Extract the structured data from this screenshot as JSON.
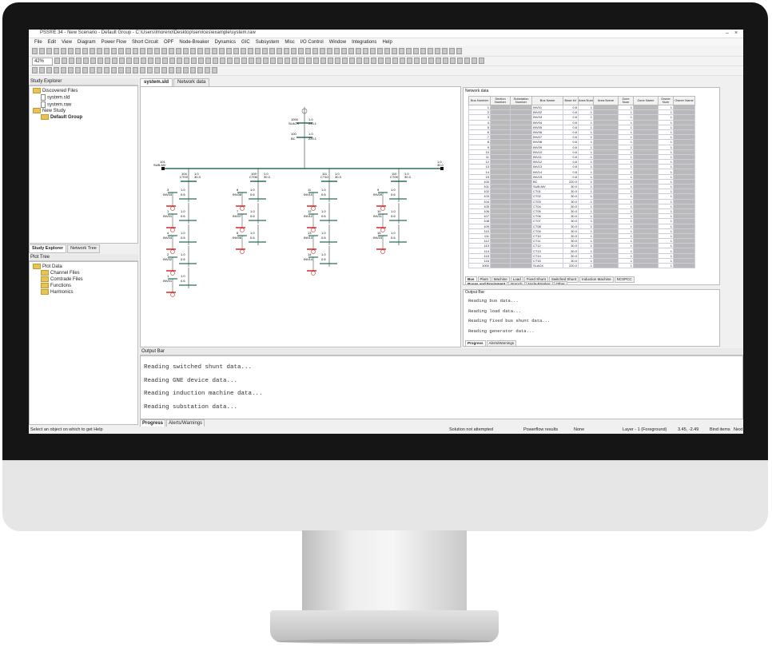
{
  "window": {
    "title": "PSS®E 34 - New Scenario - Default Group - C:\\Users\\lmoreno\\Desktop\\services\\example\\system.raw"
  },
  "menu": [
    "File",
    "Edit",
    "View",
    "Diagram",
    "Power Flow",
    "Short Circuit",
    "OPF",
    "Node-Breaker",
    "Dynamics",
    "GIC",
    "Subsystem",
    "Misc",
    "I/O Control",
    "Window",
    "Integrations",
    "Help"
  ],
  "toolbar": {
    "zoom": "42%"
  },
  "study_explorer": {
    "title": "Study Explorer",
    "items": [
      {
        "label": "Discovered Files",
        "type": "folder",
        "level": 0
      },
      {
        "label": "system.sld",
        "type": "file",
        "level": 1
      },
      {
        "label": "system.raw",
        "type": "file",
        "level": 1
      },
      {
        "label": "New Study",
        "type": "folder",
        "level": 0
      },
      {
        "label": "Default Group",
        "type": "folder-bold",
        "level": 1
      }
    ],
    "tabs": [
      "Study Explorer",
      "Network Tree"
    ]
  },
  "plot_tree": {
    "title": "Plot Tree",
    "items": [
      {
        "label": "Plot Data",
        "level": 0
      },
      {
        "label": "Channel Files",
        "level": 1
      },
      {
        "label": "Comtrade Files",
        "level": 1
      },
      {
        "label": "Functions",
        "level": 1
      },
      {
        "label": "Harmonics",
        "level": 1
      }
    ]
  },
  "doc_tabs": [
    "system.sld",
    "Network data"
  ],
  "network_data": {
    "title": "Network data",
    "columns": [
      "Bus Number",
      "Section Number",
      "Substation Number",
      "Bus Name",
      "Base kV",
      "Area Num",
      "Area Name",
      "Zone Num",
      "Zone Name",
      "Owner Num",
      "Owner Name"
    ],
    "rows": [
      [
        "1",
        "INV01",
        "0.6"
      ],
      [
        "2",
        "INV02",
        "0.6"
      ],
      [
        "3",
        "INV03",
        "0.6"
      ],
      [
        "4",
        "INV04",
        "0.6"
      ],
      [
        "5",
        "INV05",
        "0.6"
      ],
      [
        "6",
        "INV06",
        "0.6"
      ],
      [
        "7",
        "INV07",
        "0.6"
      ],
      [
        "8",
        "INV08",
        "0.6"
      ],
      [
        "9",
        "INV09",
        "0.6"
      ],
      [
        "10",
        "INV10",
        "0.6"
      ],
      [
        "11",
        "INV11",
        "0.6"
      ],
      [
        "12",
        "INV12",
        "0.6"
      ],
      [
        "13",
        "INV13",
        "0.6"
      ],
      [
        "14",
        "INV14",
        "0.6"
      ],
      [
        "15",
        "INV15",
        "0.6"
      ],
      [
        "100",
        "BC",
        "220.0"
      ],
      [
        "101",
        "SUB-MV",
        "30.0"
      ],
      [
        "102",
        "CT01",
        "30.0"
      ],
      [
        "103",
        "CT02",
        "30.0"
      ],
      [
        "104",
        "CT03",
        "30.0"
      ],
      [
        "105",
        "CT04",
        "30.0"
      ],
      [
        "106",
        "CT05",
        "30.0"
      ],
      [
        "107",
        "CT06",
        "30.0"
      ],
      [
        "108",
        "CT07",
        "30.0"
      ],
      [
        "109",
        "CT08",
        "30.0"
      ],
      [
        "110",
        "CT09",
        "30.0"
      ],
      [
        "111",
        "CT10",
        "30.0"
      ],
      [
        "112",
        "CT11",
        "30.0"
      ],
      [
        "113",
        "CT12",
        "30.0"
      ],
      [
        "114",
        "CT13",
        "30.0"
      ],
      [
        "115",
        "CT14",
        "30.0"
      ],
      [
        "116",
        "CT15",
        "30.0"
      ],
      [
        "1000",
        "SLACK",
        "220.0"
      ]
    ],
    "sheet_tabs_1": [
      "Bus",
      "Plant",
      "Machine",
      "Load",
      "Fixed Shunt",
      "Switched Shunt",
      "Induction Machine",
      "NCSPCC"
    ],
    "sheet_tabs_2": [
      "Buses and Equipment",
      "Branch",
      "Node-Breaker",
      "Other"
    ]
  },
  "output_small": {
    "title": "Output Bar",
    "lines": [
      "Reading bus data...",
      "Reading load data...",
      "Reading fixed bus shunt data...",
      "Reading generator data..."
    ],
    "tabs": [
      "Progress",
      "Alerts/Warnings"
    ]
  },
  "output_big": {
    "title": "Output Bar",
    "lines": [
      "Reading switched shunt data...",
      "Reading GNE device data...",
      "Reading induction machine data...",
      "Reading substation data..."
    ],
    "tabs": [
      "Progress",
      "Alerts/Warnings"
    ]
  },
  "status": {
    "help": "Select an object on which to get Help",
    "solution": "Solution not attempted",
    "powerflow": "Powerflow results",
    "none": "None",
    "layer": "Layer - 1 (Foreground)",
    "coords": "3.45, -2.49",
    "bind": "Bind items",
    "next": "Next"
  },
  "diagram": {
    "slack": {
      "num": "1000",
      "name": "SLACK",
      "v1": "1.0",
      "v2": "220.1"
    },
    "bc": {
      "num": "100",
      "name": "BC",
      "v1": "1.0",
      "v2": "220.1"
    },
    "submv": {
      "num": "101",
      "name": "SUB-MV",
      "v1": "1.0",
      "v2": "30.0"
    },
    "feeders": [
      {
        "ct": "CT03",
        "ctnum": "104",
        "invs": [
          [
            "3",
            "INV03"
          ],
          [
            "1",
            "INV01"
          ],
          [
            "4",
            "INV04"
          ],
          [
            "2",
            "INV02"
          ],
          [
            "1",
            "INV01"
          ]
        ]
      },
      {
        "ct": "CT06",
        "ctnum": "109",
        "invs": [
          [
            "8",
            "INV08"
          ],
          [
            "7",
            "INV07"
          ],
          [
            "6",
            "INV06"
          ]
        ]
      },
      {
        "ct": "CT10",
        "ctnum": "111",
        "invs": [
          [
            "11",
            "INV10"
          ],
          [
            "12",
            "INV12"
          ],
          [
            "13",
            "INV13"
          ],
          [
            "14",
            "INV14"
          ]
        ]
      },
      {
        "ct": "CT09",
        "ctnum": "110",
        "invs": [
          [
            "9",
            "INV09"
          ],
          [
            "10",
            "INV11"
          ],
          [
            "15",
            "INV15"
          ]
        ]
      }
    ]
  }
}
